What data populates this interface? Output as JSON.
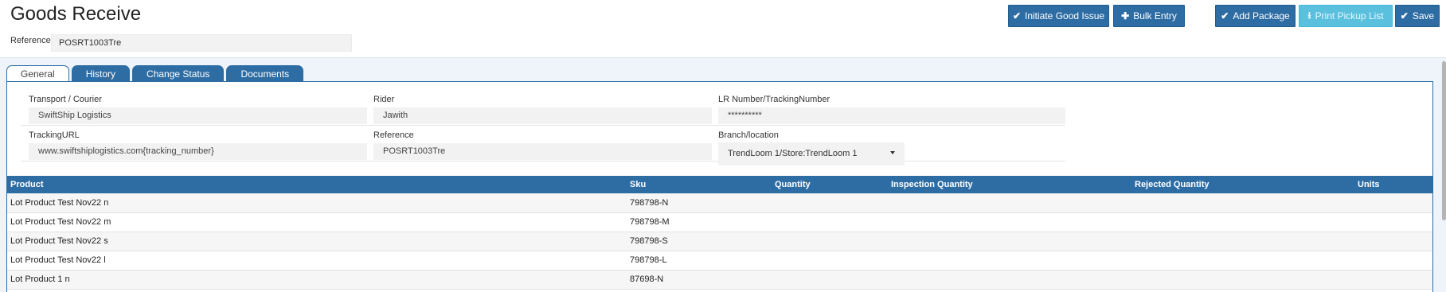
{
  "page": {
    "title": "Goods Receive"
  },
  "reference": {
    "label": "Reference",
    "value": "POSRT1003Tre"
  },
  "toolbar": {
    "initiate_label": "Initiate Good Issue",
    "bulk_label": "Bulk Entry",
    "add_package_label": "Add Package",
    "print_label": "Print Pickup List",
    "save_label": "Save"
  },
  "tabs": [
    {
      "label": "General",
      "active": true
    },
    {
      "label": "History"
    },
    {
      "label": "Change Status"
    },
    {
      "label": "Documents"
    }
  ],
  "form": {
    "transport": {
      "label": "Transport / Courier",
      "value": "SwiftShip Logistics"
    },
    "rider": {
      "label": "Rider",
      "value": "Jawith"
    },
    "lr": {
      "label": "LR Number/TrackingNumber",
      "value": "**********"
    },
    "tracking_url": {
      "label": "TrackingURL",
      "value": "www.swiftshiplogistics.com{tracking_number}"
    },
    "reference": {
      "label": "Reference",
      "value": "POSRT1003Tre"
    },
    "branch": {
      "label": "Branch/location",
      "value": "TrendLoom 1/Store:TrendLoom 1"
    }
  },
  "table": {
    "columns": [
      "Product",
      "Sku",
      "Quantity",
      "Inspection Quantity",
      "Rejected Quantity",
      "Units"
    ],
    "rows": [
      {
        "product": "Lot Product Test Nov22 n",
        "sku": "798798-N"
      },
      {
        "product": "Lot Product Test Nov22 m",
        "sku": "798798-M"
      },
      {
        "product": "Lot Product Test Nov22 s",
        "sku": "798798-S"
      },
      {
        "product": "Lot Product Test Nov22 l",
        "sku": "798798-L"
      },
      {
        "product": "Lot Product 1 n",
        "sku": "87698-N"
      }
    ]
  },
  "colors": {
    "primary": "#2e6da4",
    "info": "#5bc0de",
    "panel_bg": "#eef4fa"
  },
  "icons": {
    "initiate": "check-icon",
    "bulk": "plus-icon",
    "add_package": "check-icon",
    "print": "download-icon",
    "save": "check-icon",
    "select": "caret-down-icon"
  }
}
